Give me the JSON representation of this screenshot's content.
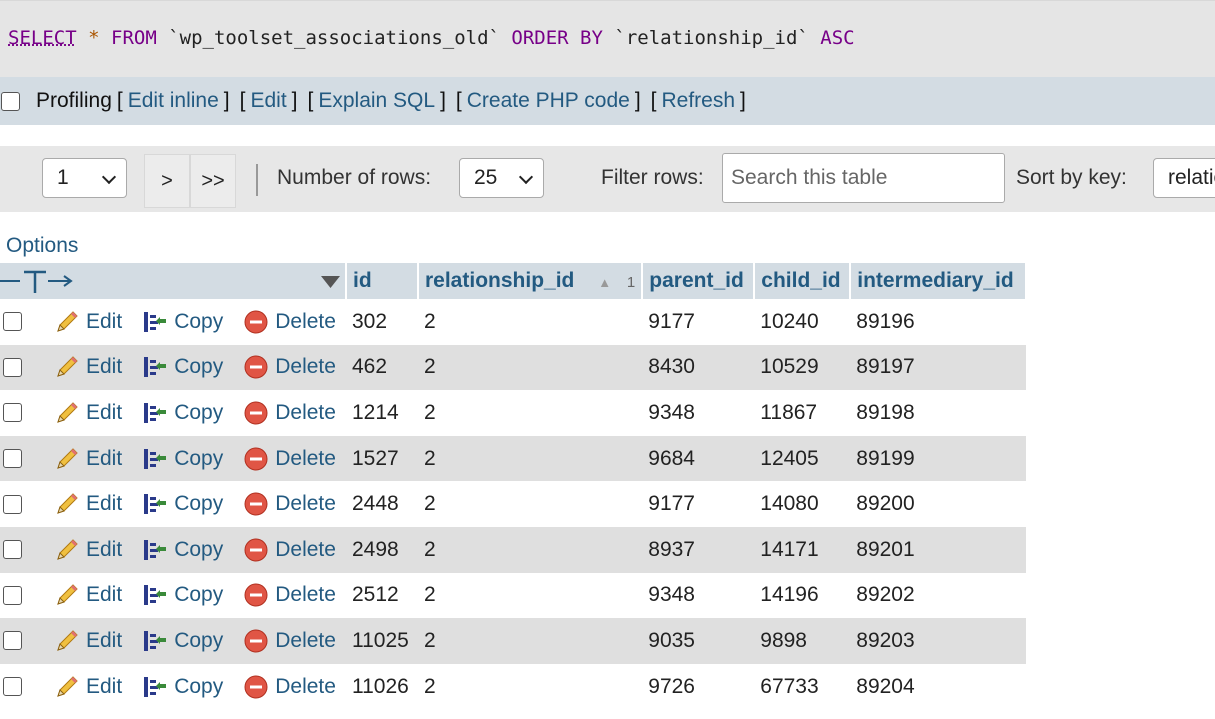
{
  "sql": {
    "select": "SELECT",
    "star": "*",
    "from": "FROM",
    "table": "`wp_toolset_associations_old`",
    "order_by": "ORDER BY",
    "column": "`relationship_id`",
    "dir": "ASC"
  },
  "profiling": {
    "label": "Profiling",
    "links": [
      "Edit inline",
      "Edit",
      "Explain SQL",
      "Create PHP code",
      "Refresh"
    ]
  },
  "nav": {
    "page_value": "1",
    "next": ">",
    "last": ">>",
    "rows_label": "Number of rows:",
    "rows_value": "25",
    "filter_label": "Filter rows:",
    "search_placeholder": "Search this table",
    "sort_label": "Sort by key:",
    "sort_value": "relatio"
  },
  "options_label": "Options",
  "table": {
    "columns": [
      "id",
      "relationship_id",
      "parent_id",
      "child_id",
      "intermediary_id"
    ],
    "sort_index": "1",
    "actions": {
      "edit": "Edit",
      "copy": "Copy",
      "delete": "Delete"
    },
    "rows": [
      [
        "302",
        "2",
        "9177",
        "10240",
        "89196"
      ],
      [
        "462",
        "2",
        "8430",
        "10529",
        "89197"
      ],
      [
        "1214",
        "2",
        "9348",
        "11867",
        "89198"
      ],
      [
        "1527",
        "2",
        "9684",
        "12405",
        "89199"
      ],
      [
        "2448",
        "2",
        "9177",
        "14080",
        "89200"
      ],
      [
        "2498",
        "2",
        "8937",
        "14171",
        "89201"
      ],
      [
        "2512",
        "2",
        "9348",
        "14196",
        "89202"
      ],
      [
        "11025",
        "2",
        "9035",
        "9898",
        "89203"
      ],
      [
        "11026",
        "2",
        "9726",
        "67733",
        "89204"
      ]
    ]
  },
  "colors": {
    "header_bg": "#d3dce3",
    "link": "#235a81",
    "row_even": "#dfdfdf",
    "keyword": "#770088"
  }
}
